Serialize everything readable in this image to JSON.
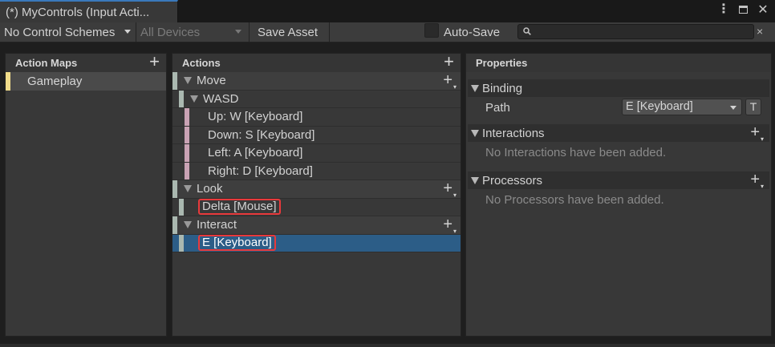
{
  "window": {
    "tab_title": "(*) MyControls (Input Acti...",
    "icons": [
      "kebab-menu-icon",
      "maximize-icon",
      "close-icon"
    ],
    "kebab_glyph": "⋮",
    "close_glyph": "✕"
  },
  "toolbar": {
    "control_schemes": "No Control Schemes",
    "devices": "All Devices",
    "save_asset": "Save Asset",
    "auto_save_label": "Auto-Save",
    "auto_save_checked": false,
    "search_placeholder": "",
    "search_clear": "×"
  },
  "action_maps": {
    "header": "Action Maps",
    "add": "+",
    "items": [
      {
        "label": "Gameplay",
        "selected": true,
        "color": "#f1dc8a"
      }
    ]
  },
  "actions": {
    "header": "Actions",
    "add": "+",
    "rows": [
      {
        "label": "Move",
        "kind": "action"
      },
      {
        "label": "WASD",
        "kind": "composite"
      },
      {
        "label": "Up: W [Keyboard]",
        "kind": "part"
      },
      {
        "label": "Down: S [Keyboard]",
        "kind": "part"
      },
      {
        "label": "Left: A [Keyboard]",
        "kind": "part"
      },
      {
        "label": "Right: D [Keyboard]",
        "kind": "part"
      },
      {
        "label": "Look",
        "kind": "action"
      },
      {
        "label": "Delta [Mouse]",
        "kind": "binding",
        "highlighted": true
      },
      {
        "label": "Interact",
        "kind": "action"
      },
      {
        "label": "E [Keyboard]",
        "kind": "binding",
        "highlighted": true,
        "selected": true
      }
    ],
    "row_add": "+"
  },
  "properties": {
    "header": "Properties",
    "binding_section": "Binding",
    "path_label": "Path",
    "path_value": "E [Keyboard]",
    "t_button": "T",
    "interactions_section": "Interactions",
    "interactions_empty": "No Interactions have been added.",
    "processors_section": "Processors",
    "processors_empty": "No Processors have been added."
  },
  "colors": {
    "selection": "#2c5d87",
    "highlight_box": "#e8393b",
    "action_strip": "#aab8b0",
    "part_strip": "#c9a2b4",
    "map_strip": "#f1dc8a"
  }
}
